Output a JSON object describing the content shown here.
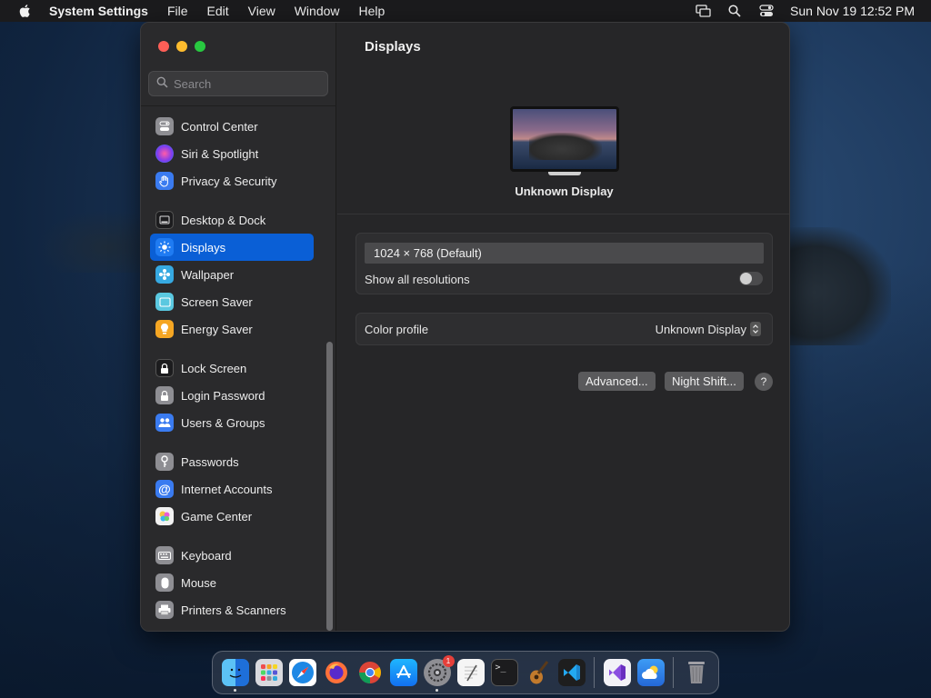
{
  "menubar": {
    "app_name": "System Settings",
    "menus": [
      "File",
      "Edit",
      "View",
      "Window",
      "Help"
    ],
    "clock": "Sun Nov 19  12:52 PM",
    "status_icons": [
      "screen-mirroring-icon",
      "spotlight-search-icon",
      "control-center-icon"
    ]
  },
  "window": {
    "search": {
      "placeholder": "Search",
      "value": ""
    },
    "sidebar": {
      "items": [
        {
          "label": "Control Center",
          "icon": "control-center-icon",
          "color": "#8e8e93"
        },
        {
          "label": "Siri & Spotlight",
          "icon": "siri-icon",
          "color": "#b548c6"
        },
        {
          "label": "Privacy & Security",
          "icon": "hand-icon",
          "color": "#3a7bf0"
        },
        {
          "label": "Desktop & Dock",
          "icon": "dock-icon",
          "color": "#1c1c1e"
        },
        {
          "label": "Displays",
          "icon": "sun-icon",
          "color": "#1f7bf2",
          "selected": true
        },
        {
          "label": "Wallpaper",
          "icon": "flower-icon",
          "color": "#36a9e1"
        },
        {
          "label": "Screen Saver",
          "icon": "screen-saver-icon",
          "color": "#5ac8e0"
        },
        {
          "label": "Energy Saver",
          "icon": "lightbulb-icon",
          "color": "#f5a623"
        },
        {
          "label": "Lock Screen",
          "icon": "lock-icon",
          "color": "#1c1c1e"
        },
        {
          "label": "Login Password",
          "icon": "lock-icon",
          "color": "#8e8e93"
        },
        {
          "label": "Users & Groups",
          "icon": "users-icon",
          "color": "#3a7bf0"
        },
        {
          "label": "Passwords",
          "icon": "key-icon",
          "color": "#8e8e93"
        },
        {
          "label": "Internet Accounts",
          "icon": "at-sign-icon",
          "color": "#3a7bf0"
        },
        {
          "label": "Game Center",
          "icon": "game-center-icon",
          "color": "#f2f2f2"
        },
        {
          "label": "Keyboard",
          "icon": "keyboard-icon",
          "color": "#8e8e93"
        },
        {
          "label": "Mouse",
          "icon": "mouse-icon",
          "color": "#8e8e93"
        },
        {
          "label": "Printers & Scanners",
          "icon": "printer-icon",
          "color": "#8e8e93"
        }
      ]
    },
    "content": {
      "title": "Displays",
      "display_name": "Unknown Display",
      "resolution": "1024 × 768 (Default)",
      "show_all_resolutions_label": "Show all resolutions",
      "show_all_resolutions_on": false,
      "color_profile_label": "Color profile",
      "color_profile_value": "Unknown Display",
      "advanced_button": "Advanced...",
      "night_shift_button": "Night Shift...",
      "help_button": "?"
    }
  },
  "dock": {
    "items": [
      {
        "name": "finder",
        "running": true
      },
      {
        "name": "launchpad"
      },
      {
        "name": "safari"
      },
      {
        "name": "firefox"
      },
      {
        "name": "chrome"
      },
      {
        "name": "app-store"
      },
      {
        "name": "system-settings",
        "running": true,
        "badge": "1"
      },
      {
        "name": "textedit"
      },
      {
        "name": "terminal"
      },
      {
        "name": "garageband"
      },
      {
        "name": "vscode"
      },
      {
        "name": "visual-studio"
      },
      {
        "name": "weather"
      },
      {
        "name": "trash"
      }
    ]
  }
}
